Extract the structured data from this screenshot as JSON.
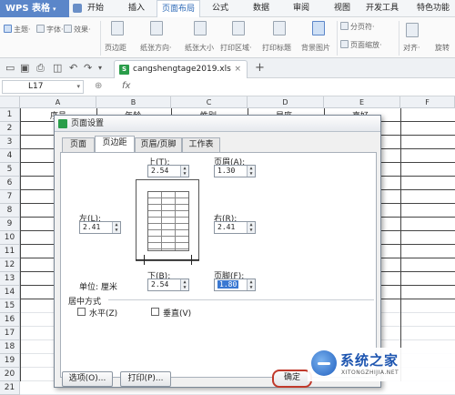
{
  "app": {
    "brand": "WPS 表格",
    "brand_caret": "▾"
  },
  "menu": [
    "开始",
    "插入",
    "页面布局",
    "公式",
    "数据",
    "审阅",
    "视图",
    "开发工具",
    "特色功能"
  ],
  "ribbon": {
    "theme": "主题·",
    "font": "字体·",
    "effect": "效果·",
    "margin": "页边距",
    "orientation": "纸张方向·",
    "size": "纸张大小",
    "print_area": "打印区域·",
    "print_title": "打印标题",
    "background": "背景图片",
    "page_break": "分页符·",
    "page_zoom": "页面缩放·",
    "align": "对齐·",
    "rotate": "旋转"
  },
  "filetab": {
    "name": "cangshengtage2019.xls",
    "close": "×",
    "icon": "S",
    "add": "+"
  },
  "formula": {
    "cell_ref": "L17",
    "fx": "fx",
    "dd": "▾"
  },
  "columns": [
    "A",
    "B",
    "C",
    "D",
    "E",
    "F"
  ],
  "rows": [
    "1",
    "2",
    "3",
    "4",
    "5",
    "6",
    "7",
    "8",
    "9",
    "10",
    "11",
    "12",
    "13",
    "14",
    "15",
    "16",
    "17",
    "18",
    "19",
    "20",
    "21"
  ],
  "headers_row1": [
    "序号",
    "年龄",
    "性别",
    "星座",
    "喜好"
  ],
  "dialog": {
    "title": "页面设置",
    "tabs": [
      "页面",
      "页边距",
      "页眉/页脚",
      "工作表"
    ],
    "top_label": "上(T):",
    "top_value": "2.54",
    "header_label": "页眉(A):",
    "header_value": "1.30",
    "left_label": "左(L):",
    "left_value": "2.41",
    "right_label": "右(R):",
    "right_value": "2.41",
    "bottom_label": "下(B):",
    "bottom_value": "2.54",
    "footer_label": "页脚(F):",
    "footer_value": "1.80",
    "unit": "单位: 厘米",
    "center_group": "居中方式",
    "horizontal": "水平(Z)",
    "vertical": "垂直(V)",
    "options_btn": "选项(O)...",
    "print_btn": "打印(P)...",
    "ok_btn": "确定"
  },
  "watermark": {
    "title": "系统之家",
    "sub": "XITONGZHIJIA.NET"
  }
}
